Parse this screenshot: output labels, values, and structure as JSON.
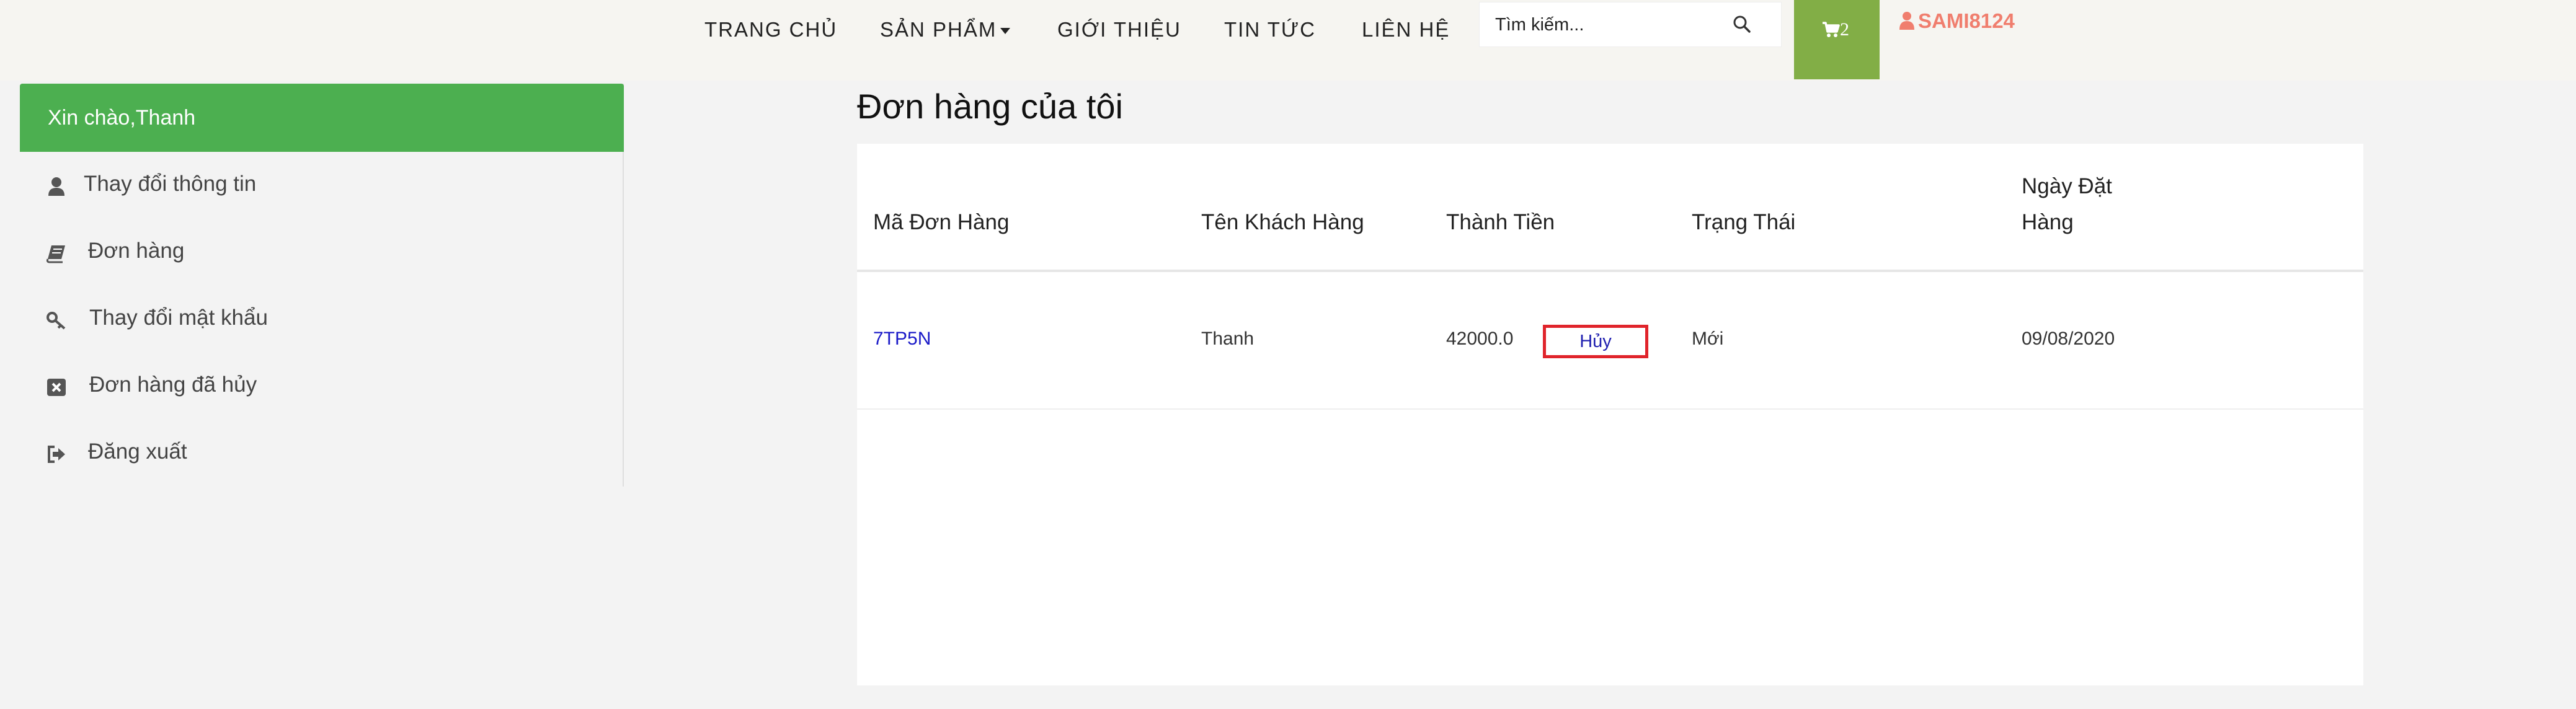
{
  "nav": {
    "home": "TRANG CHỦ",
    "products": "SẢN PHẨM",
    "about": "GIỚI THIỆU",
    "news": "TIN TỨC",
    "contact": "LIÊN HỆ"
  },
  "search": {
    "placeholder": "Tìm kiếm..."
  },
  "cart": {
    "count": "2"
  },
  "user": {
    "name": "SAMI8124"
  },
  "sidebar": {
    "greeting": "Xin chào,Thanh",
    "items": [
      {
        "label": "Thay đổi thông tin",
        "icon": "user-icon"
      },
      {
        "label": "Đơn hàng",
        "icon": "book-icon"
      },
      {
        "label": "Thay đổi mật khẩu",
        "icon": "key-icon"
      },
      {
        "label": "Đơn hàng đã hủy",
        "icon": "close-square-icon"
      },
      {
        "label": "Đăng xuất",
        "icon": "sign-out-icon"
      }
    ]
  },
  "orders": {
    "title": "Đơn hàng của tôi",
    "columns": {
      "code": "Mã Đơn Hàng",
      "customer": "Tên Khách Hàng",
      "total": "Thành Tiền",
      "status": "Trạng Thái",
      "date_line1": "Ngày Đặt",
      "date_line2": "Hàng"
    },
    "rows": [
      {
        "code": "7TP5N",
        "customer": "Thanh",
        "total": "42000.0",
        "status": "Mới",
        "date": "09/08/2020",
        "action": "Hủy"
      }
    ]
  },
  "colors": {
    "accent_green": "#4caf50",
    "cart_green": "#82ae46",
    "user_color": "#f07e6e",
    "cancel_border": "#e0242b"
  }
}
